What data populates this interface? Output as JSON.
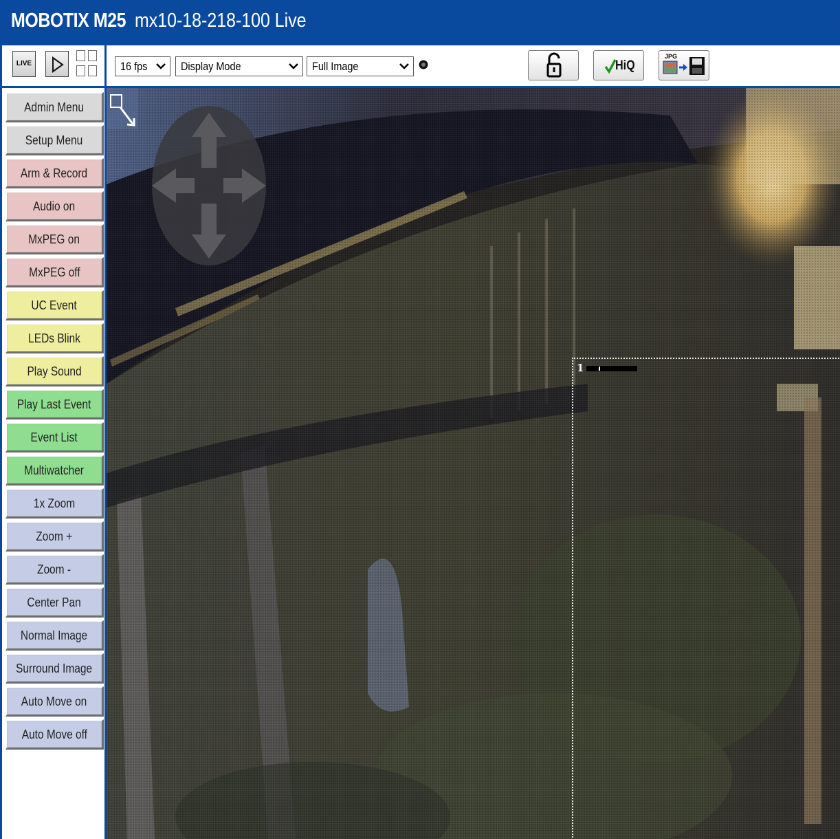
{
  "window": {
    "brand": "MOBOTIX M25",
    "camera_name": "mx10-18-218-100 Live"
  },
  "toolbar": {
    "live_label": "LIVE",
    "play_icon": "play-icon",
    "layout_icon": "grid-layout-icon",
    "fps_select": "16 fps",
    "display_mode_select": "Display Mode",
    "image_select": "Full Image",
    "status_indicator_icon": "status-dot-icon",
    "lock_icon": "unlock-icon",
    "hiq_label": "HiQ",
    "jpg_label": "JPG",
    "save_icon": "save-floppy-icon"
  },
  "sidebar": {
    "buttons": [
      {
        "label": "Admin Menu",
        "color": "#d9d9d9"
      },
      {
        "label": "Setup Menu",
        "color": "#d9d9d9"
      },
      {
        "label": "Arm & Record",
        "color": "#e8c4c4"
      },
      {
        "label": "Audio on",
        "color": "#e8c4c4"
      },
      {
        "label": "MxPEG on",
        "color": "#e8c4c4"
      },
      {
        "label": "MxPEG off",
        "color": "#e8c4c4"
      },
      {
        "label": "UC Event",
        "color": "#eeee9e"
      },
      {
        "label": "LEDs Blink",
        "color": "#eeee9e"
      },
      {
        "label": "Play Sound",
        "color": "#eeee9e"
      },
      {
        "label": "Play Last Event",
        "color": "#8fde90"
      },
      {
        "label": "Event List",
        "color": "#8fde90"
      },
      {
        "label": "Multiwatcher",
        "color": "#8fde90"
      },
      {
        "label": "1x Zoom",
        "color": "#c5cde6"
      },
      {
        "label": "Zoom +",
        "color": "#c5cde6"
      },
      {
        "label": "Zoom -",
        "color": "#c5cde6"
      },
      {
        "label": "Center Pan",
        "color": "#c5cde6"
      },
      {
        "label": "Normal Image",
        "color": "#c5cde6"
      },
      {
        "label": "Surround Image",
        "color": "#c5cde6"
      },
      {
        "label": "Auto Move on",
        "color": "#c5cde6"
      },
      {
        "label": "Auto Move off",
        "color": "#c5cde6"
      }
    ]
  },
  "camera": {
    "zoom_tool_icon": "zoom-select-icon",
    "pan_pad_icon": "pan-arrows-icon",
    "roi_number": "1"
  }
}
